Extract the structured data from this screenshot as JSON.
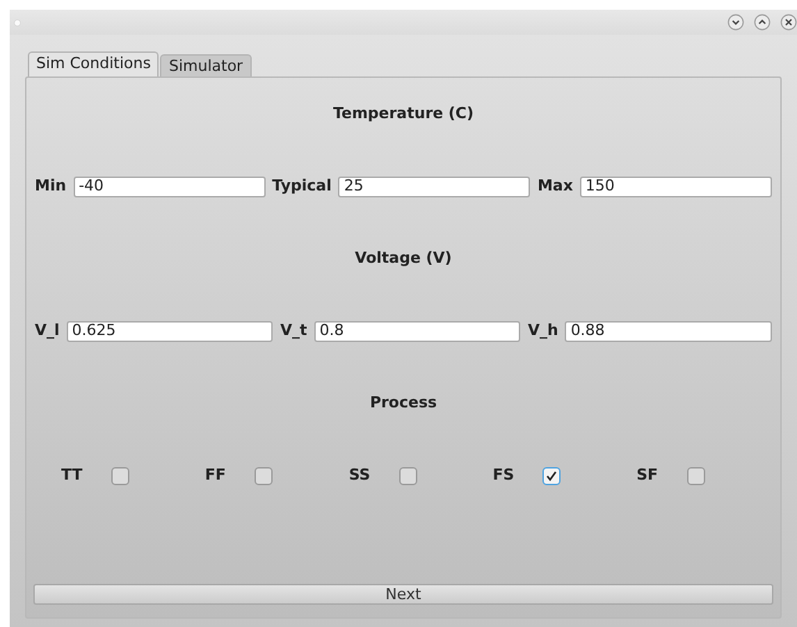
{
  "tabs": [
    {
      "label": "Sim Conditions",
      "selected": true
    },
    {
      "label": "Simulator",
      "selected": false
    }
  ],
  "sections": [
    {
      "heading": "Temperature (C)",
      "kind": "fields",
      "fields": [
        {
          "label": "Min",
          "value": "-40"
        },
        {
          "label": "Typical",
          "value": "25"
        },
        {
          "label": "Max",
          "value": "150"
        }
      ]
    },
    {
      "heading": "Voltage (V)",
      "kind": "fields",
      "fields": [
        {
          "label": "V_l",
          "value": "0.625"
        },
        {
          "label": "V_t",
          "value": "0.8"
        },
        {
          "label": "V_h",
          "value": "0.88"
        }
      ]
    },
    {
      "heading": "Process",
      "kind": "checks",
      "checks": [
        {
          "label": "TT",
          "checked": false
        },
        {
          "label": "FF",
          "checked": false
        },
        {
          "label": "SS",
          "checked": false
        },
        {
          "label": "FS",
          "checked": true
        },
        {
          "label": "SF",
          "checked": false
        }
      ]
    }
  ],
  "next_button": "Next"
}
